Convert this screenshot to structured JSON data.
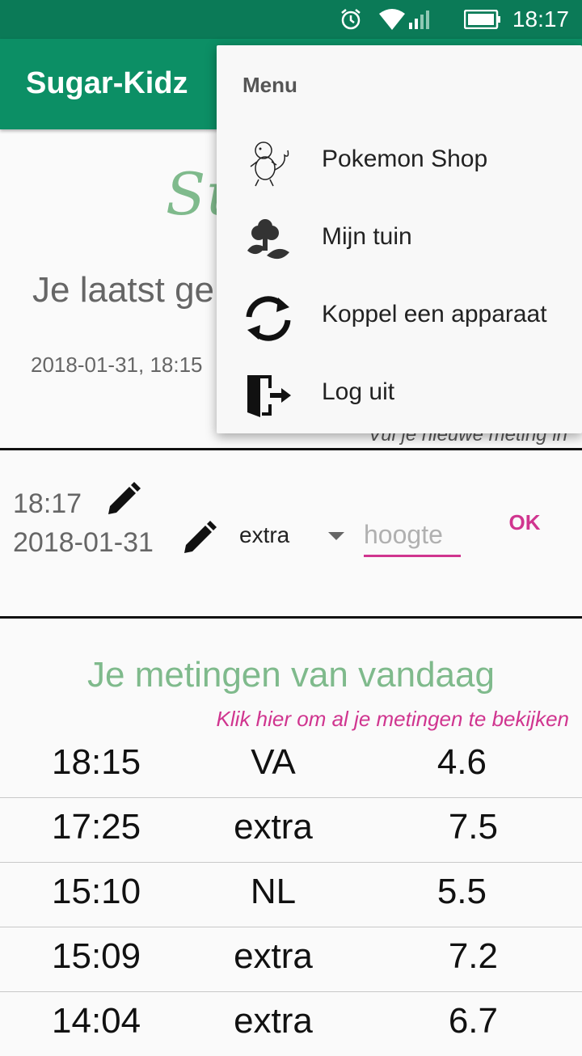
{
  "status_bar": {
    "time": "18:17"
  },
  "appbar": {
    "title": "Sugar-Kidz"
  },
  "main": {
    "script_title": "Su",
    "last_heading": "Je laatst ge",
    "last_datetime": "2018-01-31, 18:15",
    "hint": "Vul je nieuwe meting in"
  },
  "entry": {
    "time": "18:17",
    "date": "2018-01-31",
    "type_selected": "extra",
    "height_placeholder": "hoogte",
    "ok_label": "OK"
  },
  "today": {
    "title": "Je metingen van vandaag",
    "all_link": "Klik hier om al je metingen te bekijken",
    "rows": [
      {
        "time": "18:15",
        "type": "VA",
        "value": "4.6"
      },
      {
        "time": "17:25",
        "type": "extra",
        "value": "7.5"
      },
      {
        "time": "15:10",
        "type": "NL",
        "value": "5.5"
      },
      {
        "time": "15:09",
        "type": "extra",
        "value": "7.2"
      },
      {
        "time": "14:04",
        "type": "extra",
        "value": "6.7"
      }
    ]
  },
  "menu": {
    "header": "Menu",
    "items": [
      {
        "label": "Pokemon Shop",
        "icon": "pokemon-icon"
      },
      {
        "label": "Mijn tuin",
        "icon": "garden-icon"
      },
      {
        "label": "Koppel een apparaat",
        "icon": "sync-icon"
      },
      {
        "label": "Log uit",
        "icon": "logout-icon"
      }
    ]
  },
  "colors": {
    "primary": "#0c8f65",
    "status_bar": "#0b7a57",
    "accent": "#d0358f",
    "title_green": "#7fba8c"
  }
}
